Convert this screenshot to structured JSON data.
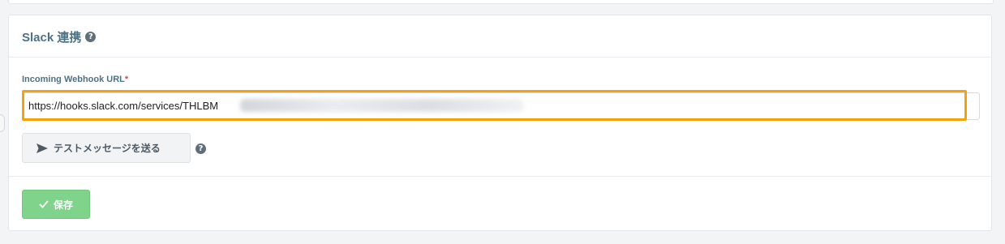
{
  "card": {
    "title": "Slack 連携",
    "help_icon": "question-circle-icon"
  },
  "webhook": {
    "label": "Incoming Webhook URL",
    "required_mark": "*",
    "value": "https://hooks.slack.com/services/THLBM"
  },
  "buttons": {
    "send_test_label": "テストメッセージを送る",
    "send_icon": "paper-plane-icon",
    "save_label": "保存",
    "save_icon": "check-icon"
  },
  "colors": {
    "title": "#4f7184",
    "highlight": "#f5a20a",
    "save_bg": "#7fd38a"
  }
}
